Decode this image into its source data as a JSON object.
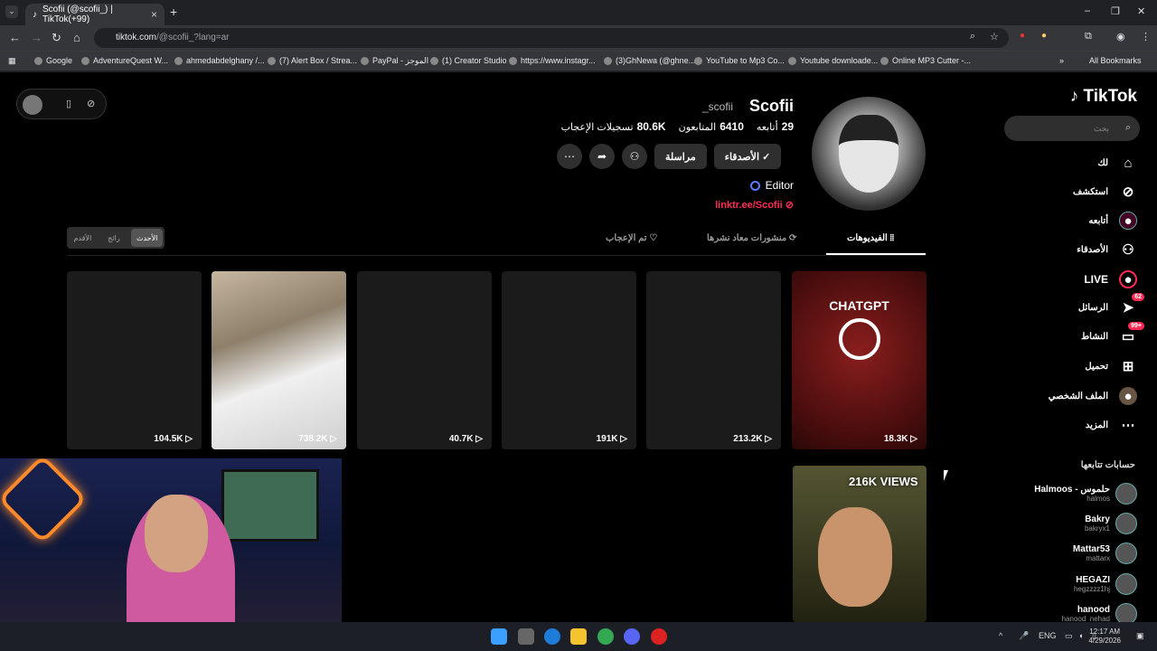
{
  "browser": {
    "tab_title": "Scofii (@scofii_) | TikTok(+99)",
    "url_host": "tiktok.com",
    "url_path": "/@scofii_?lang=ar",
    "bookmarks": [
      "Google",
      "AdventureQuest W...",
      "ahmedabdelghany /...",
      "(7) Alert Box / Strea...",
      "PayPal - الموجز",
      "(1) Creator Studio",
      "https://www.instagr...",
      "(3)GhNewa (@ghne...",
      "YouTube to Mp3 Co...",
      "Youtube downloade...",
      "Online MP3 Cutter -..."
    ],
    "all_bookmarks": "All Bookmarks"
  },
  "sidebar": {
    "logo": "TikTok",
    "search_placeholder": "بحث",
    "items": [
      {
        "label": "لك",
        "icon": "home-icon"
      },
      {
        "label": "استكشف",
        "icon": "compass-icon"
      },
      {
        "label": "أتابعه",
        "icon": "following-icon"
      },
      {
        "label": "الأصدقاء",
        "icon": "friends-icon"
      },
      {
        "label": "LIVE",
        "icon": "live-icon"
      },
      {
        "label": "الرسائل",
        "icon": "messages-icon",
        "badge": "62"
      },
      {
        "label": "النشاط",
        "icon": "activity-icon",
        "badge": "99+"
      },
      {
        "label": "تحميل",
        "icon": "upload-icon"
      },
      {
        "label": "الملف الشخصي",
        "icon": "profile-icon"
      },
      {
        "label": "المزيد",
        "icon": "more-icon"
      }
    ],
    "following_title": "حسابات تتابعها",
    "accounts": [
      {
        "name": "Halmoos - حلموس",
        "user": "halmos"
      },
      {
        "name": "Bakry",
        "user": "bakryx1"
      },
      {
        "name": "Mattar53",
        "user": "mattarx"
      },
      {
        "name": "HEGAZI",
        "user": "hegzzzz1hj"
      },
      {
        "name": "hanood",
        "user": "hanood_nehad"
      }
    ]
  },
  "profile": {
    "name": "Scofii",
    "username": "_scofii",
    "following_count": "29",
    "following_label": "أتابعه",
    "followers_count": "6410",
    "followers_label": "المتابعون",
    "likes_count": "80.6K",
    "likes_label": "تسجيلات الإعجاب",
    "friends_button": "الأصدقاء",
    "message_button": "مراسلة",
    "editor_label": "Editor",
    "link": "linktr.ee/Scofii"
  },
  "tabs": {
    "videos": "الفيديوهات",
    "reposts": "منشورات معاد نشرها",
    "liked": "تم الإعجاب"
  },
  "sort": {
    "latest": "الأحدث",
    "popular": "رائج",
    "oldest": "الأقدم"
  },
  "videos": [
    {
      "views": "18.3K",
      "title": "CHATGPT"
    },
    {
      "views": "213.2K"
    },
    {
      "views": "191K"
    },
    {
      "views": "40.7K"
    },
    {
      "views": "738.2K"
    },
    {
      "views": "104.5K"
    }
  ],
  "second_row_overlay": "216K VIEWS",
  "taskbar": {
    "lang": "ENG",
    "time": "12:17 AM",
    "date": "4/29/2026"
  }
}
